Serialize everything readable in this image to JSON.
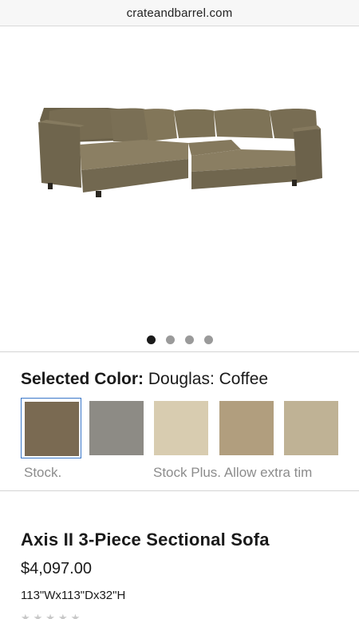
{
  "browser": {
    "url": "crateandbarrel.com"
  },
  "gallery": {
    "image_alt": "",
    "dots": [
      {
        "active": true
      },
      {
        "active": false
      },
      {
        "active": false
      },
      {
        "active": false
      }
    ]
  },
  "color_picker": {
    "label": "Selected Color:",
    "value": "Douglas: Coffee",
    "swatches": [
      {
        "name": "Douglas: Coffee",
        "color": "#7a6a52",
        "selected": true
      },
      {
        "name": "gray",
        "color": "#8d8b85",
        "selected": false
      },
      {
        "name": "cream",
        "color": "#d8ccb0",
        "selected": false
      },
      {
        "name": "tan",
        "color": "#b19e7e",
        "selected": false
      },
      {
        "name": "sand",
        "color": "#bfb295",
        "selected": false
      }
    ],
    "stock_label": "Stock.",
    "stock_plus_label": "Stock Plus. Allow extra tim"
  },
  "product": {
    "title": "Axis II 3-Piece Sectional Sofa",
    "price": "$4,097.00",
    "dimensions": "113\"Wx113\"Dx32\"H"
  },
  "colors": {
    "sofa": "#7b7058",
    "selected_border": "#3a77c8"
  }
}
